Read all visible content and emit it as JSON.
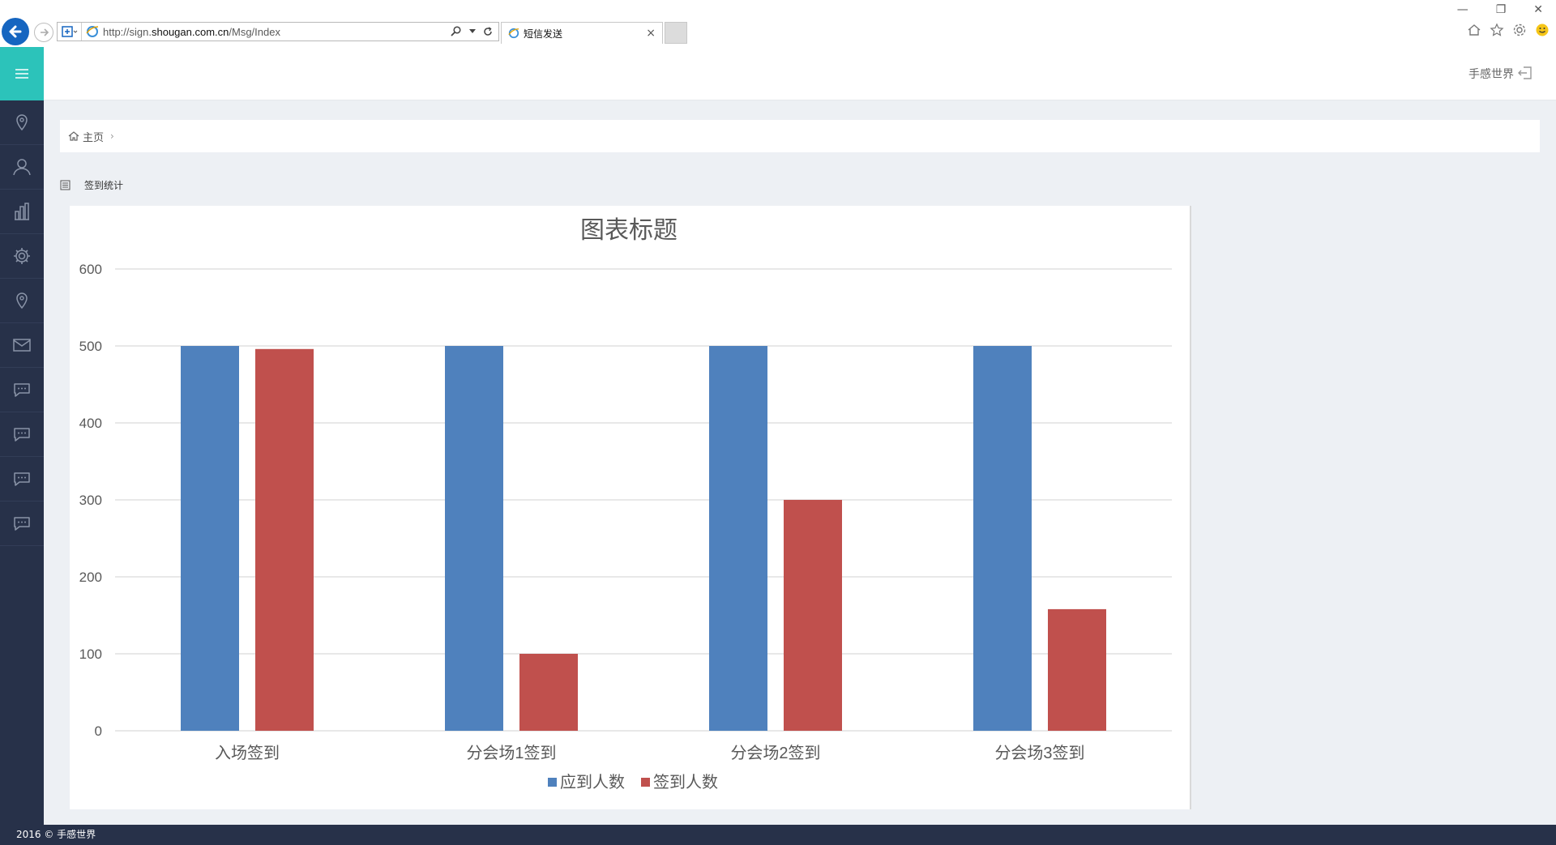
{
  "browser": {
    "url_prefix": "http://sign.",
    "url_domain": "shougan.com.cn",
    "url_path": "/Msg/Index",
    "tab_title": "短信发送",
    "tab_close": "×",
    "win_minimize": "—",
    "win_restore": "❐",
    "win_close": "✕"
  },
  "header": {
    "user_name": "手感世界"
  },
  "breadcrumb": {
    "home_label": "主页",
    "separator": "›"
  },
  "section": {
    "title": "签到统计"
  },
  "footer": {
    "text": "2016 © 手感世界"
  },
  "colors": {
    "sidebar_bg": "#273149",
    "sidebar_accent": "#2cc3ba",
    "series_blue": "#4f81bd",
    "series_red": "#c0504d"
  },
  "chart_data": {
    "type": "bar",
    "title": "图表标题",
    "categories": [
      "入场签到",
      "分会场1签到",
      "分会场2签到",
      "分会场3签到"
    ],
    "series": [
      {
        "name": "应到人数",
        "values": [
          500,
          500,
          500,
          500
        ],
        "color": "#4f81bd"
      },
      {
        "name": "签到人数",
        "values": [
          496,
          100,
          300,
          158
        ],
        "color": "#c0504d"
      }
    ],
    "ylim": [
      0,
      600
    ],
    "yticks": [
      0,
      100,
      200,
      300,
      400,
      500,
      600
    ],
    "grid": true,
    "legend": "bottom"
  }
}
